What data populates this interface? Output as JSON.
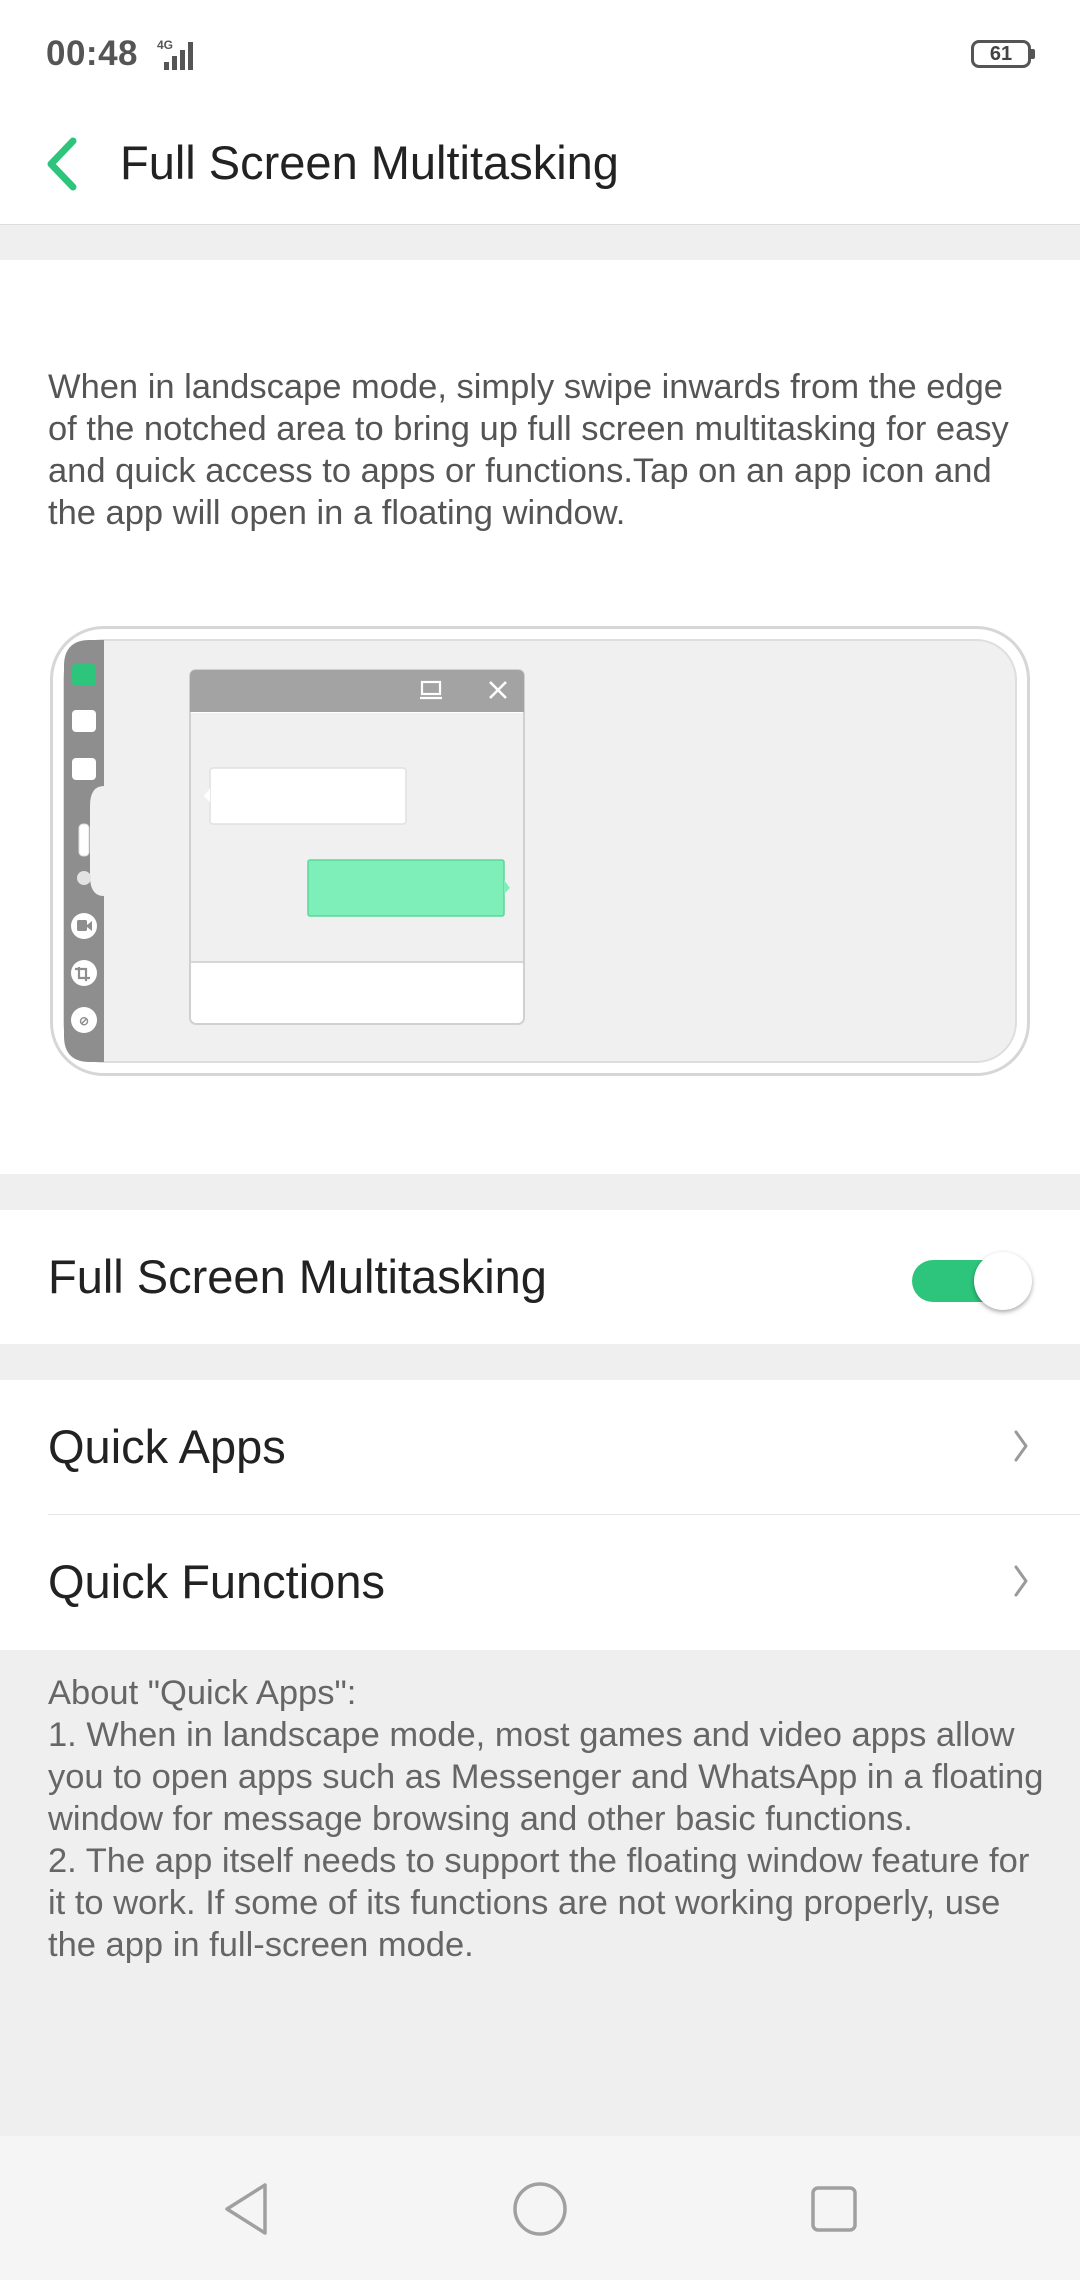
{
  "status_bar": {
    "time": "00:48",
    "network": "4G",
    "battery": "61"
  },
  "header": {
    "title": "Full Screen Multitasking"
  },
  "intro": {
    "description": "When in landscape mode, simply swipe inwards from the edge of the notched area to bring up full screen multitasking for easy and quick access to apps or functions.Tap on an app icon and the app will open in a floating window."
  },
  "settings": {
    "toggle_label": "Full Screen Multitasking",
    "toggle_on": true,
    "quick_apps_label": "Quick Apps",
    "quick_functions_label": "Quick Functions"
  },
  "about": {
    "text": "About \"Quick Apps\":\n1. When in landscape mode, most games and video apps allow you to open apps such as Messenger and WhatsApp in a floating window for message browsing and other basic functions.\n2. The app itself needs to support the floating window feature for it to work. If some of its functions are not working properly, use the app in full-screen mode."
  },
  "colors": {
    "accent": "#2dc57b",
    "bubble": "#7eefb8",
    "background": "#efefef"
  },
  "icons": {
    "back": "chevron-left-icon",
    "chevron": "chevron-right-icon",
    "nav_back": "triangle-back-icon",
    "nav_home": "circle-home-icon",
    "nav_recents": "square-recents-icon"
  }
}
